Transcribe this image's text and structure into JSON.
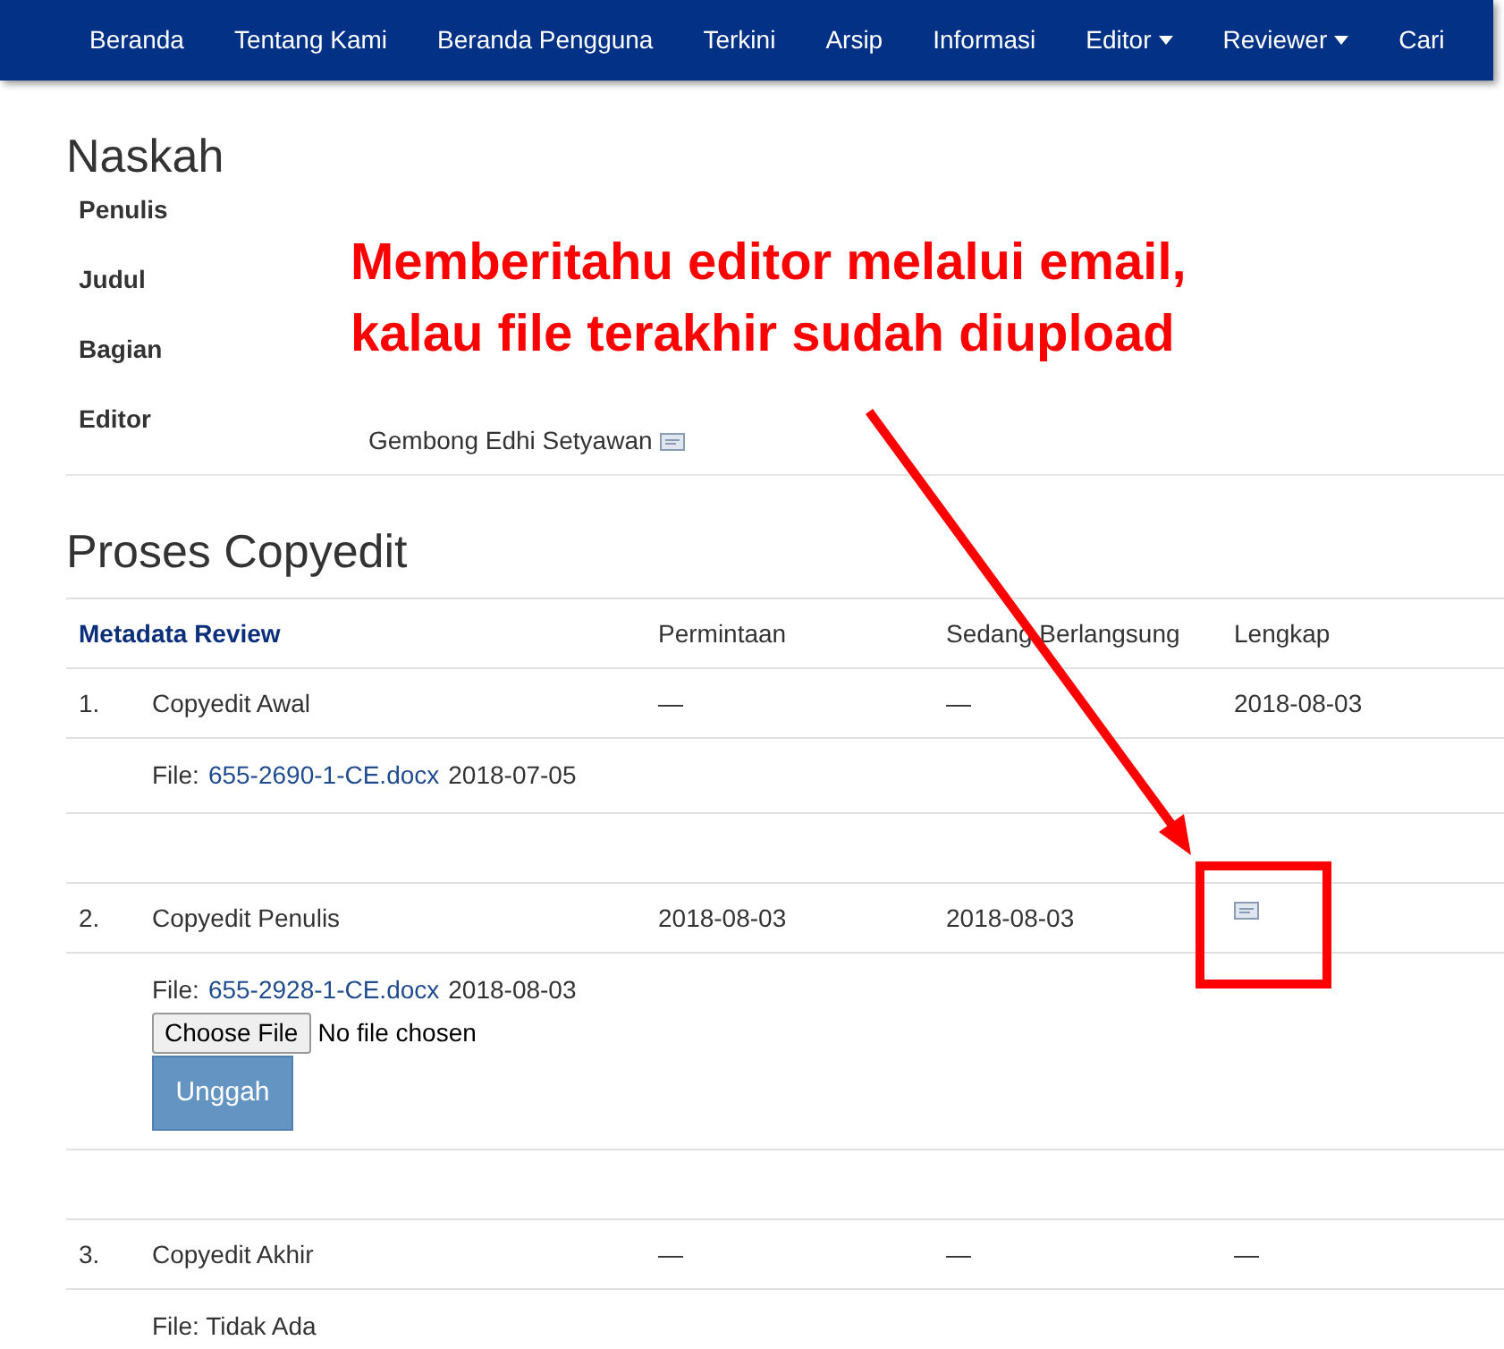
{
  "nav": {
    "items": [
      {
        "label": "Beranda",
        "dropdown": false
      },
      {
        "label": "Tentang Kami",
        "dropdown": false
      },
      {
        "label": "Beranda Pengguna",
        "dropdown": false
      },
      {
        "label": "Terkini",
        "dropdown": false
      },
      {
        "label": "Arsip",
        "dropdown": false
      },
      {
        "label": "Informasi",
        "dropdown": false
      },
      {
        "label": "Editor",
        "dropdown": true
      },
      {
        "label": "Reviewer",
        "dropdown": true
      },
      {
        "label": "Cari",
        "dropdown": false
      }
    ]
  },
  "submission": {
    "title": "Naskah",
    "fields": [
      {
        "label": "Penulis"
      },
      {
        "label": "Judul"
      },
      {
        "label": "Bagian"
      },
      {
        "label": "Editor",
        "value": "Gembong Edhi Setyawan",
        "mail_icon": true
      }
    ]
  },
  "copyedit": {
    "title": "Proses Copyedit",
    "columns": [
      "Metadata Review",
      "Permintaan",
      "Sedang Berlangsung",
      "Lengkap"
    ],
    "steps": [
      {
        "number": "1.",
        "name": "Copyedit Awal",
        "requested": "—",
        "underway": "—",
        "complete": {
          "kind": "text",
          "text": "2018-08-03"
        },
        "file_label": "File:",
        "file_link": "655-2690-1-CE.docx",
        "file_date": "2018-07-05"
      },
      {
        "number": "2.",
        "name": "Copyedit Penulis",
        "requested": "2018-08-03",
        "underway": "2018-08-03",
        "complete": {
          "kind": "mail"
        },
        "file_label": "File:",
        "file_link": "655-2928-1-CE.docx",
        "file_date": "2018-08-03",
        "upload": {
          "choose_label": "Choose File",
          "status": "No file chosen",
          "submit_label": "Unggah"
        }
      },
      {
        "number": "3.",
        "name": "Copyedit Akhir",
        "requested": "—",
        "underway": "—",
        "complete": {
          "kind": "text",
          "text": "—"
        },
        "file_label": "File: Tidak Ada"
      }
    ]
  },
  "annotation": {
    "lines": [
      "Memberitahu editor melalui email,",
      "kalau file terakhir sudah diupload"
    ]
  }
}
